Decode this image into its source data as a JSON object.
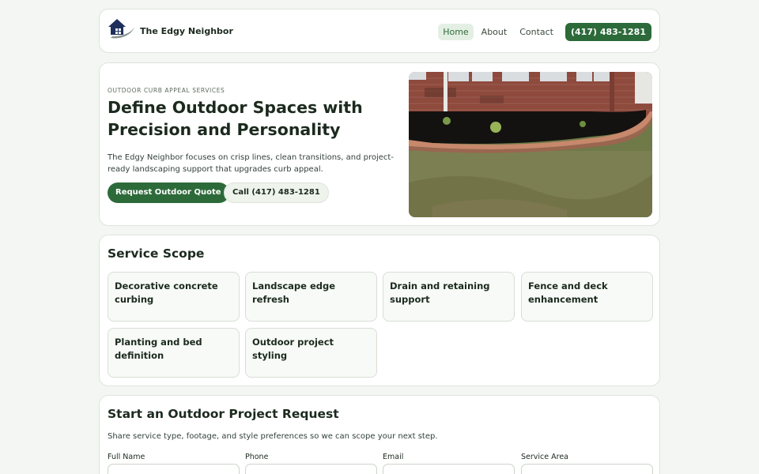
{
  "header": {
    "brand": "The Edgy Neighbor",
    "nav": [
      {
        "label": "Home"
      },
      {
        "label": "About"
      },
      {
        "label": "Contact"
      }
    ],
    "phone_label": "(417) 483-1281"
  },
  "hero": {
    "eyebrow": "OUTDOOR CURB APPEAL SERVICES",
    "title": "Define Outdoor Spaces with Precision and Personality",
    "description": "The Edgy Neighbor focuses on crisp lines, clean transitions, and project-ready landscaping support that upgrades curb appeal.",
    "primary_cta": "Request Outdoor Quote",
    "secondary_cta": "Call (417) 483-1281"
  },
  "services": {
    "title": "Service Scope",
    "items": [
      "Decorative concrete curbing",
      "Landscape edge refresh",
      "Drain and retaining support",
      "Fence and deck enhancement",
      "Planting and bed definition",
      "Outdoor project styling"
    ]
  },
  "form": {
    "title": "Start an Outdoor Project Request",
    "description": "Share service type, footage, and style preferences so we can scope your next step.",
    "fields": [
      {
        "label": "Full Name",
        "value": ""
      },
      {
        "label": "Phone",
        "value": ""
      },
      {
        "label": "Email",
        "value": ""
      },
      {
        "label": "Service Area",
        "value": ""
      }
    ]
  },
  "colors": {
    "accent": "#2d6a3a",
    "background": "#f3f6f2",
    "text": "#1c2a1e"
  }
}
